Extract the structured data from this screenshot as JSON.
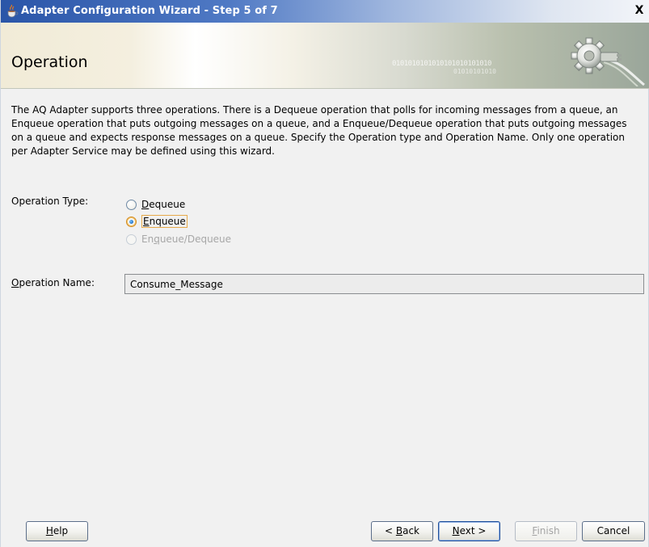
{
  "window": {
    "title": "Adapter Configuration Wizard - Step 5 of 7",
    "close_label": "X"
  },
  "header": {
    "step_title": "Operation",
    "binary_text": "0101010101010101010101010",
    "binary_text2": "01010101010"
  },
  "description": "The AQ Adapter supports three operations.  There is a Dequeue operation that polls for incoming messages from a queue, an Enqueue operation that puts outgoing messages on a queue, and a Enqueue/Dequeue operation that puts outgoing messages on a queue and expects response messages on a queue.  Specify the Operation type and Operation Name. Only one operation per Adapter Service may be defined using this wizard.",
  "operation_type": {
    "label": "Operation Type:",
    "options": [
      {
        "mnemonic": "D",
        "rest": "equeue",
        "selected": false,
        "enabled": true
      },
      {
        "mnemonic": "E",
        "rest": "nqueue",
        "selected": true,
        "enabled": true
      },
      {
        "pre": "En",
        "mnemonic": "q",
        "rest": "ueue/Dequeue",
        "selected": false,
        "enabled": false
      }
    ]
  },
  "operation_name": {
    "label_mnemonic": "O",
    "label_rest": "peration Name:",
    "value": "Consume_Message"
  },
  "buttons": {
    "help": {
      "mnemonic": "H",
      "rest": "elp"
    },
    "back": {
      "pre": "< ",
      "mnemonic": "B",
      "rest": "ack"
    },
    "next": {
      "mnemonic": "N",
      "rest": "ext >"
    },
    "finish": {
      "mnemonic": "F",
      "rest": "inish"
    },
    "cancel": {
      "label": "Cancel"
    }
  }
}
